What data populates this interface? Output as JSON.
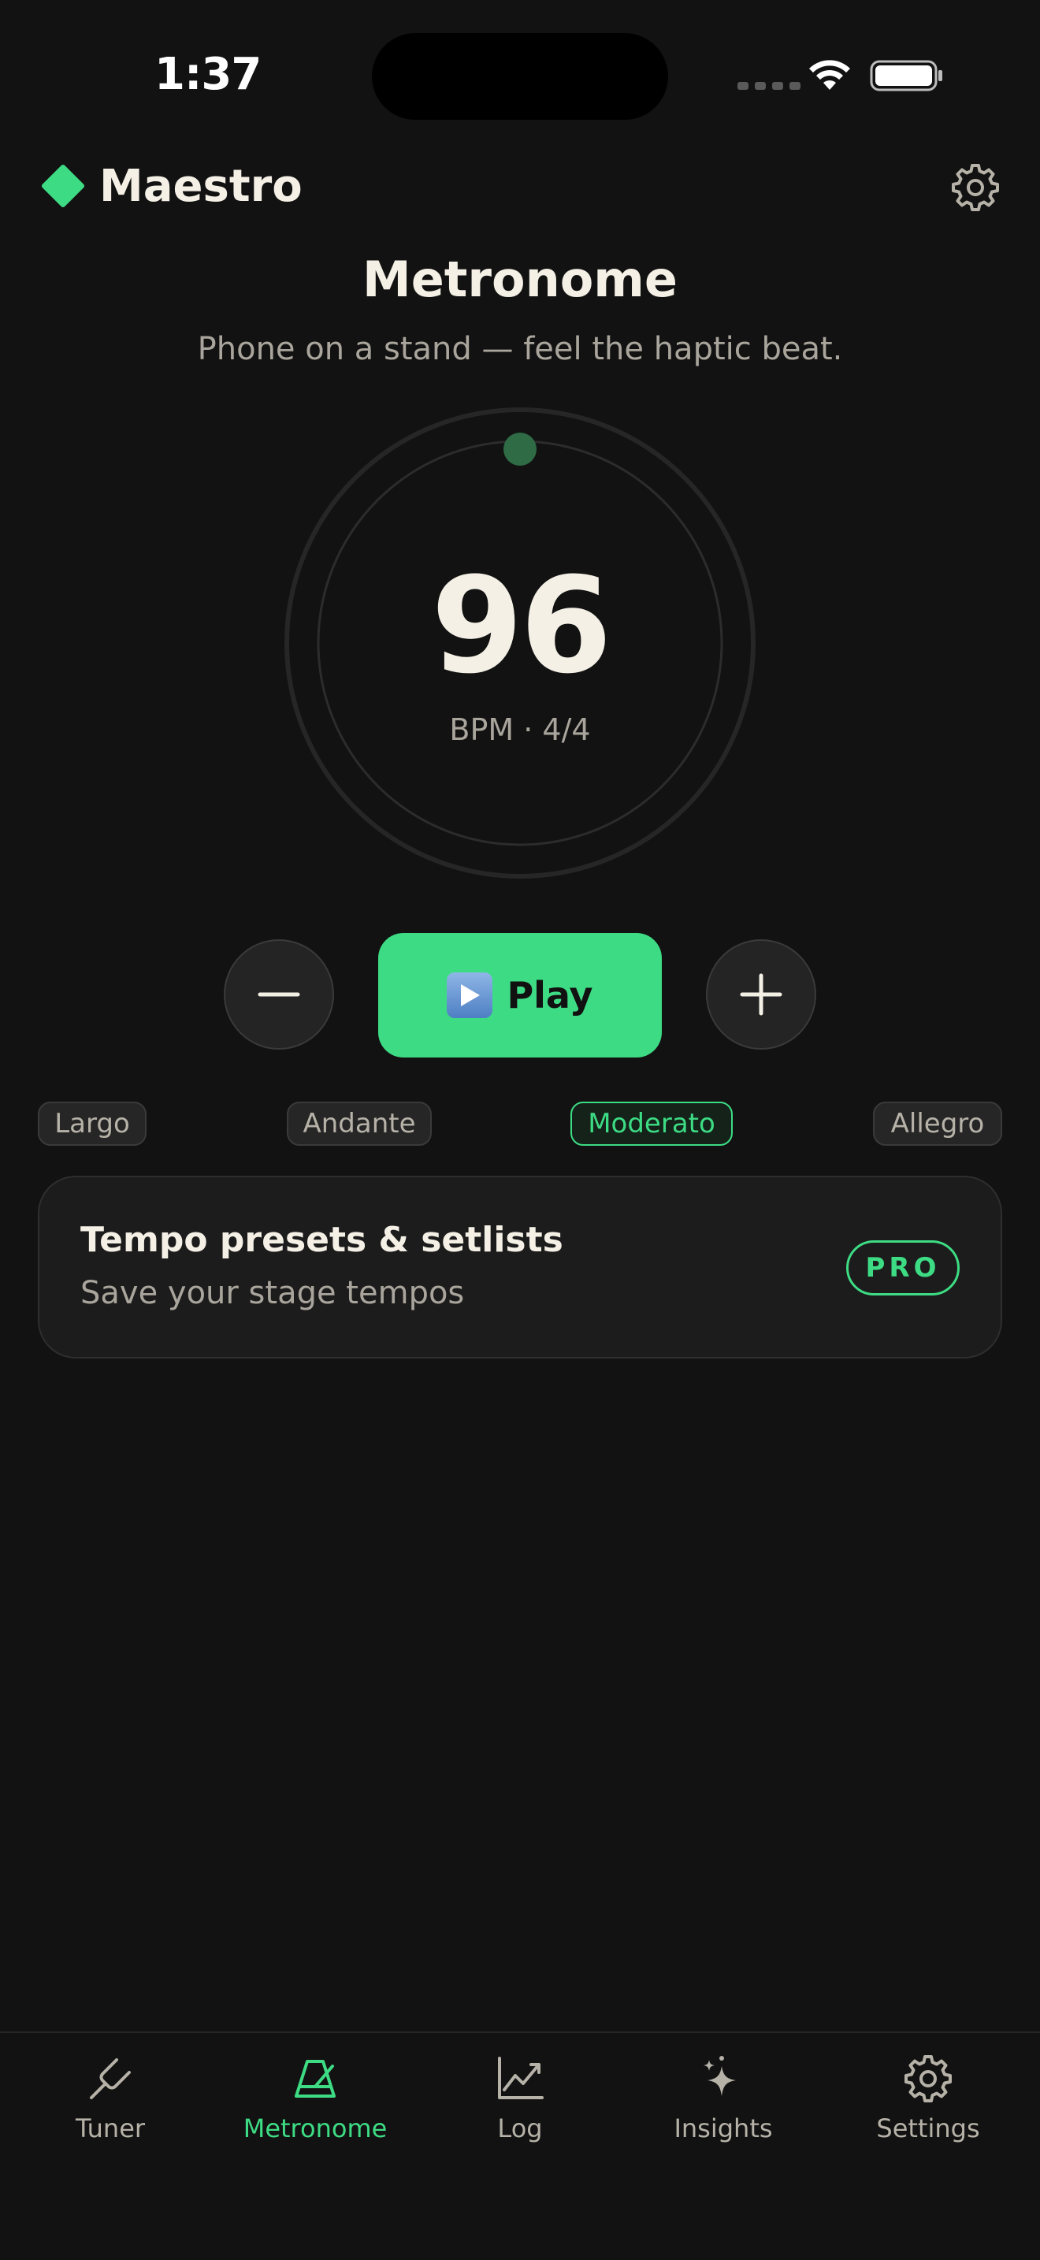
{
  "status_bar": {
    "time": "1:37",
    "icons": [
      "signal-dots-icon",
      "wifi-icon",
      "battery-icon"
    ]
  },
  "header": {
    "app_name": "Maestro",
    "logo_icon": "diamond-icon",
    "settings_icon": "gear-icon"
  },
  "page": {
    "title": "Metronome",
    "subtitle": "Phone on a stand — feel the haptic beat."
  },
  "dial": {
    "bpm": "96",
    "caption": "BPM · 4/4"
  },
  "controls": {
    "decrease_icon": "minus-icon",
    "play_label": "Play",
    "play_icon": "play-emoji-icon",
    "increase_icon": "plus-icon"
  },
  "tempo_presets": {
    "items": [
      {
        "label": "Largo",
        "selected": false
      },
      {
        "label": "Andante",
        "selected": false
      },
      {
        "label": "Moderato",
        "selected": true
      },
      {
        "label": "Allegro",
        "selected": false
      }
    ]
  },
  "preset_card": {
    "title": "Tempo presets & setlists",
    "subtitle": "Save your stage tempos",
    "badge": "PRO"
  },
  "tab_bar": {
    "items": [
      {
        "label": "Tuner",
        "icon": "tuning-fork-icon",
        "active": false
      },
      {
        "label": "Metronome",
        "icon": "metronome-icon",
        "active": true
      },
      {
        "label": "Log",
        "icon": "chart-line-icon",
        "active": false
      },
      {
        "label": "Insights",
        "icon": "sparkle-icon",
        "active": false
      },
      {
        "label": "Settings",
        "icon": "gear-icon",
        "active": false
      }
    ]
  },
  "colors": {
    "background": "#121212",
    "accent": "#3ddc84",
    "text_primary": "#f4f0e6",
    "text_secondary": "#a9a59c"
  }
}
